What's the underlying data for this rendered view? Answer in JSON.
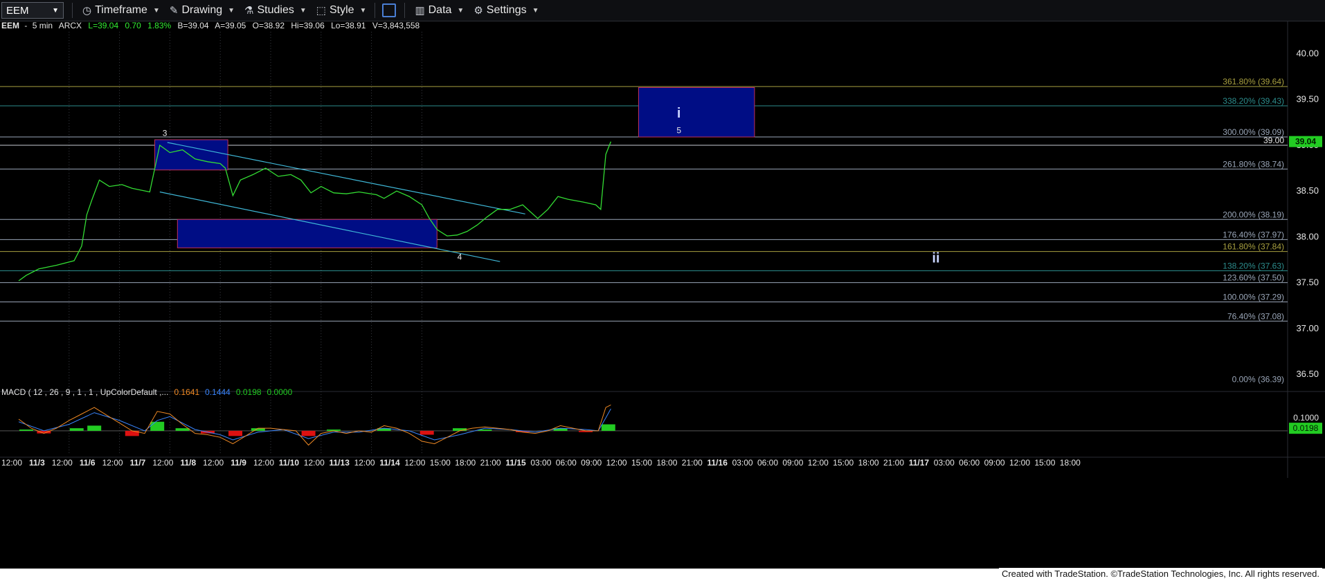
{
  "toolbar": {
    "symbol": "EEM",
    "timeframe": "Timeframe",
    "drawing": "Drawing",
    "studies": "Studies",
    "style": "Style",
    "data": "Data",
    "settings": "Settings"
  },
  "quote": {
    "symbol": "EEM",
    "interval": "5 min",
    "exchange": "ARCX",
    "last": "L=39.04",
    "change": "0.70",
    "pct": "1.83%",
    "bid": "B=39.04",
    "ask": "A=39.05",
    "open": "O=38.92",
    "high": "Hi=39.06",
    "low": "Lo=38.91",
    "volume": "V=3,843,558"
  },
  "footer": "Created with TradeStation. ©TradeStation Technologies, Inc. All rights reserved.",
  "chart_data": {
    "type": "line",
    "colors": {
      "price": "#33dd33",
      "background": "#000000",
      "box_fill": "#000d85",
      "box_border": "#c0305a",
      "trend": "#3fb8d8",
      "fib_gray": "#9aa6b8",
      "fib_gold": "#a8a040",
      "fib_teal": "#2c8c8c",
      "macd_line": "#f08a24",
      "signal_line": "#3a86ff",
      "hist_pos": "#22cc22",
      "hist_neg": "#dd1111",
      "last_price_bg": "#22cc22"
    },
    "price_axis": {
      "min": 36.35,
      "max": 40.2,
      "ticks": [
        "40.00",
        "39.50",
        "39.00",
        "38.50",
        "38.00",
        "37.50",
        "37.00",
        "36.50"
      ]
    },
    "time_axis": [
      "12:00",
      "11/3",
      "12:00",
      "11/6",
      "12:00",
      "11/7",
      "12:00",
      "11/8",
      "12:00",
      "11/9",
      "12:00",
      "11/10",
      "12:00",
      "11/13",
      "12:00",
      "11/14",
      "12:00",
      "15:00",
      "18:00",
      "21:00",
      "11/15",
      "03:00",
      "06:00",
      "09:00",
      "12:00",
      "15:00",
      "18:00",
      "21:00",
      "11/16",
      "03:00",
      "06:00",
      "09:00",
      "12:00",
      "15:00",
      "18:00",
      "21:00",
      "11/17",
      "03:00",
      "06:00",
      "09:00",
      "12:00",
      "15:00",
      "18:00"
    ],
    "fib_levels": [
      {
        "label": "361.80% (39.64)",
        "price": 39.64,
        "tone": "gold"
      },
      {
        "label": "338.20% (39.43)",
        "price": 39.43,
        "tone": "teal"
      },
      {
        "label": "300.00% (39.09)",
        "price": 39.09,
        "tone": "gray"
      },
      {
        "label": "261.80% (38.74)",
        "price": 38.74,
        "tone": "gray"
      },
      {
        "label": "200.00% (38.19)",
        "price": 38.19,
        "tone": "gray"
      },
      {
        "label": "176.40% (37.97)",
        "price": 37.97,
        "tone": "gray"
      },
      {
        "label": "161.80% (37.84)",
        "price": 37.84,
        "tone": "gold"
      },
      {
        "label": "138.20% (37.63)",
        "price": 37.63,
        "tone": "teal"
      },
      {
        "label": "123.60% (37.50)",
        "price": 37.5,
        "tone": "gray"
      },
      {
        "label": "100.00% (37.29)",
        "price": 37.29,
        "tone": "gray"
      },
      {
        "label": "76.40% (37.08)",
        "price": 37.08,
        "tone": "gray"
      },
      {
        "label": "0.00% (36.39)",
        "price": 36.39,
        "tone": "none"
      }
    ],
    "horizontal_line": {
      "label": "39.00",
      "price": 39.0
    },
    "last_price": "39.04",
    "wave_labels": [
      {
        "text": "3",
        "slot": 5.8,
        "price": 39.1
      },
      {
        "text": "4",
        "slot": 17.5,
        "price": 37.75
      },
      {
        "text": "i",
        "slot": 26.2,
        "price": 39.3
      },
      {
        "text": "5",
        "slot": 26.2,
        "price": 39.13
      },
      {
        "text": "ii",
        "slot": 36.4,
        "price": 37.72
      }
    ],
    "boxes": [
      {
        "slot_start": 5.4,
        "slot_end": 8.3,
        "top": 39.06,
        "bottom": 38.73
      },
      {
        "slot_start": 6.3,
        "slot_end": 16.6,
        "top": 38.19,
        "bottom": 37.88
      },
      {
        "slot_start": 24.6,
        "slot_end": 29.2,
        "top": 39.63,
        "bottom": 39.09
      }
    ],
    "trendlines": [
      {
        "from": [
          5.9,
          39.03
        ],
        "to": [
          20.1,
          38.25
        ]
      },
      {
        "from": [
          5.6,
          38.49
        ],
        "to": [
          19.1,
          37.73
        ]
      }
    ],
    "price_series": [
      [
        0,
        37.52
      ],
      [
        0.3,
        37.58
      ],
      [
        0.8,
        37.65
      ],
      [
        1.5,
        37.69
      ],
      [
        2.2,
        37.74
      ],
      [
        2.5,
        37.9
      ],
      [
        2.7,
        38.24
      ],
      [
        2.9,
        38.4
      ],
      [
        3.2,
        38.62
      ],
      [
        3.6,
        38.55
      ],
      [
        4.1,
        38.57
      ],
      [
        4.5,
        38.53
      ],
      [
        5.2,
        38.49
      ],
      [
        5.6,
        39.0
      ],
      [
        6.0,
        38.92
      ],
      [
        6.5,
        38.95
      ],
      [
        7.0,
        38.85
      ],
      [
        7.5,
        38.82
      ],
      [
        8.0,
        38.8
      ],
      [
        8.2,
        38.75
      ],
      [
        8.5,
        38.45
      ],
      [
        8.8,
        38.62
      ],
      [
        9.3,
        38.68
      ],
      [
        9.8,
        38.75
      ],
      [
        10.3,
        38.66
      ],
      [
        10.8,
        38.68
      ],
      [
        11.2,
        38.62
      ],
      [
        11.6,
        38.48
      ],
      [
        12.0,
        38.55
      ],
      [
        12.5,
        38.48
      ],
      [
        13.0,
        38.47
      ],
      [
        13.5,
        38.49
      ],
      [
        14.2,
        38.46
      ],
      [
        14.5,
        38.42
      ],
      [
        15.0,
        38.5
      ],
      [
        15.5,
        38.44
      ],
      [
        16.0,
        38.35
      ],
      [
        16.3,
        38.2
      ],
      [
        16.6,
        38.08
      ],
      [
        17.0,
        38.01
      ],
      [
        17.4,
        38.02
      ],
      [
        17.8,
        38.06
      ],
      [
        18.2,
        38.13
      ],
      [
        18.6,
        38.22
      ],
      [
        19.0,
        38.3
      ],
      [
        19.5,
        38.3
      ],
      [
        20.0,
        38.35
      ],
      [
        20.6,
        38.2
      ],
      [
        21.0,
        38.3
      ],
      [
        21.4,
        38.44
      ],
      [
        21.8,
        38.41
      ],
      [
        22.4,
        38.38
      ],
      [
        22.9,
        38.35
      ],
      [
        23.1,
        38.3
      ],
      [
        23.3,
        38.9
      ],
      [
        23.5,
        39.04
      ]
    ],
    "macd": {
      "label": "MACD ( 12 , 26 , 9 , 1 , 1 , UpColorDefault ,...",
      "macd_value": "0.1641",
      "signal_value": "0.1444",
      "diff_value": "0.0198",
      "zero_value": "0.0000",
      "axis_ticks": [
        "0.1000",
        "0.0198"
      ],
      "range": [
        -0.15,
        0.25
      ],
      "macd_series": [
        [
          0,
          0.09
        ],
        [
          0.5,
          0.02
        ],
        [
          1,
          -0.02
        ],
        [
          1.5,
          0.02
        ],
        [
          2.0,
          0.08
        ],
        [
          2.5,
          0.13
        ],
        [
          3.0,
          0.18
        ],
        [
          3.5,
          0.12
        ],
        [
          4.0,
          0.06
        ],
        [
          4.5,
          0.0
        ],
        [
          5.0,
          -0.02
        ],
        [
          5.5,
          0.15
        ],
        [
          6.0,
          0.13
        ],
        [
          6.5,
          0.05
        ],
        [
          7.0,
          -0.02
        ],
        [
          7.5,
          -0.03
        ],
        [
          8.0,
          -0.05
        ],
        [
          8.5,
          -0.1
        ],
        [
          9.0,
          -0.04
        ],
        [
          9.5,
          0.02
        ],
        [
          10.0,
          0.02
        ],
        [
          10.5,
          0.01
        ],
        [
          11.0,
          0.0
        ],
        [
          11.5,
          -0.11
        ],
        [
          12.0,
          -0.02
        ],
        [
          12.5,
          0.0
        ],
        [
          13.0,
          -0.02
        ],
        [
          13.5,
          0.0
        ],
        [
          14.0,
          -0.01
        ],
        [
          14.5,
          0.04
        ],
        [
          15.0,
          0.02
        ],
        [
          15.5,
          -0.02
        ],
        [
          16.0,
          -0.08
        ],
        [
          16.5,
          -0.1
        ],
        [
          17.0,
          -0.05
        ],
        [
          17.5,
          0.0
        ],
        [
          18.0,
          0.02
        ],
        [
          18.5,
          0.03
        ],
        [
          19.0,
          0.02
        ],
        [
          19.5,
          0.01
        ],
        [
          20.0,
          -0.01
        ],
        [
          20.5,
          -0.02
        ],
        [
          21.0,
          0.0
        ],
        [
          21.5,
          0.04
        ],
        [
          22.0,
          0.02
        ],
        [
          22.5,
          0.0
        ],
        [
          23.0,
          0.0
        ],
        [
          23.3,
          0.18
        ],
        [
          23.5,
          0.2
        ]
      ],
      "signal_series": [
        [
          0,
          0.07
        ],
        [
          1,
          0.0
        ],
        [
          2.0,
          0.05
        ],
        [
          3.0,
          0.14
        ],
        [
          4.0,
          0.08
        ],
        [
          5.0,
          0.0
        ],
        [
          5.5,
          0.08
        ],
        [
          6.0,
          0.11
        ],
        [
          7.0,
          0.01
        ],
        [
          8.0,
          -0.03
        ],
        [
          8.5,
          -0.07
        ],
        [
          9.5,
          -0.01
        ],
        [
          10.5,
          0.01
        ],
        [
          11.5,
          -0.06
        ],
        [
          12.5,
          -0.01
        ],
        [
          13.5,
          -0.01
        ],
        [
          14.5,
          0.02
        ],
        [
          15.5,
          0.0
        ],
        [
          16.5,
          -0.07
        ],
        [
          17.5,
          -0.03
        ],
        [
          18.5,
          0.02
        ],
        [
          19.5,
          0.01
        ],
        [
          20.5,
          -0.01
        ],
        [
          21.5,
          0.02
        ],
        [
          22.5,
          0.01
        ],
        [
          23.0,
          0.0
        ],
        [
          23.3,
          0.1
        ],
        [
          23.5,
          0.17
        ]
      ],
      "hist_series": [
        [
          0.3,
          0.01
        ],
        [
          1,
          -0.02
        ],
        [
          2.3,
          0.02
        ],
        [
          3.0,
          0.04
        ],
        [
          4.5,
          -0.04
        ],
        [
          5.5,
          0.07
        ],
        [
          6.5,
          0.02
        ],
        [
          7.5,
          -0.02
        ],
        [
          8.6,
          -0.04
        ],
        [
          9.5,
          0.02
        ],
        [
          11.5,
          -0.04
        ],
        [
          12.5,
          0.01
        ],
        [
          14.5,
          0.02
        ],
        [
          16.2,
          -0.03
        ],
        [
          17.5,
          0.02
        ],
        [
          18.5,
          0.01
        ],
        [
          20.0,
          -0.01
        ],
        [
          21.5,
          0.02
        ],
        [
          22.5,
          -0.01
        ],
        [
          23.4,
          0.05
        ]
      ]
    }
  }
}
